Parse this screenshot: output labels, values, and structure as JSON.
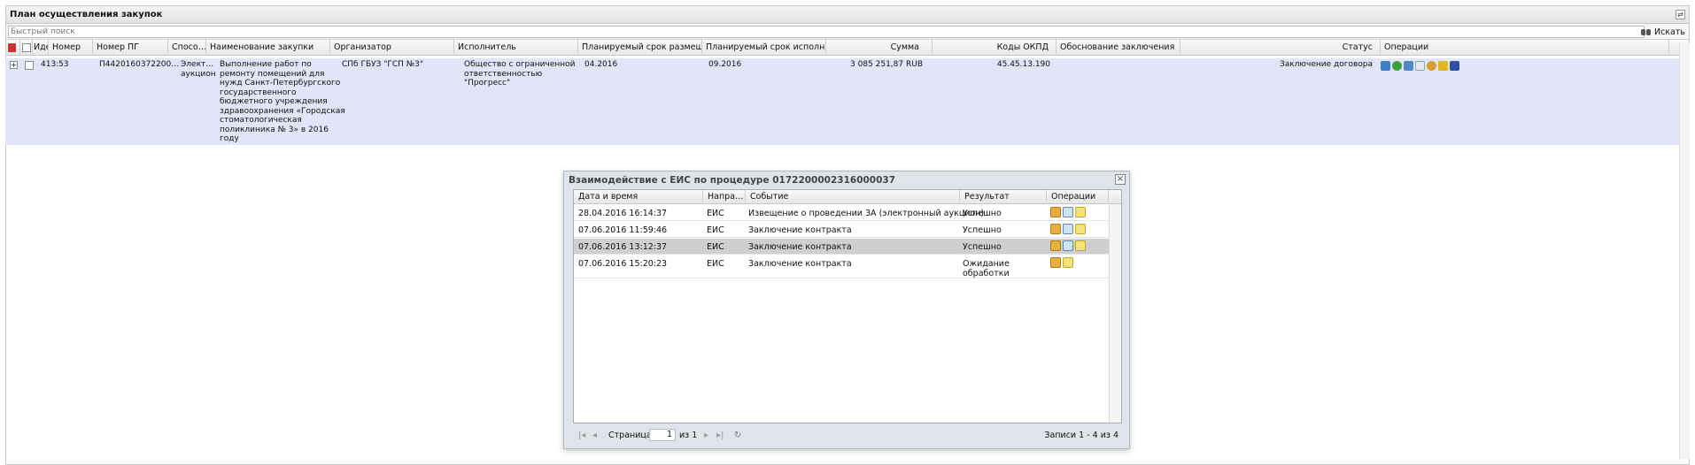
{
  "panel": {
    "title": "План осуществления закупок"
  },
  "search": {
    "placeholder": "Быстрый поиск",
    "button_label": "Искать"
  },
  "grid": {
    "columns": {
      "id": "Иде",
      "number": "Номер",
      "pg_number": "Номер ПГ",
      "method": "Спосо…",
      "name": "Наименование закупки",
      "organizer": "Организатор",
      "executor": "Исполнитель",
      "plan_post": "Планируемый срок размещ…",
      "plan_exec": "Планируемый срок исполн…",
      "sum": "Сумма",
      "okpd": "Коды ОКПД",
      "justification": "Обоснование заключения",
      "status": "Статус",
      "operations": "Операции"
    },
    "row": {
      "id": "413:",
      "number": "53",
      "pg_number": "П4420160372200…",
      "method": "Элект…\nаукцион",
      "name": "Выполнение работ по\nремонту помещений для\nнужд Санкт-Петербургского\nгосударственного\nбюджетного учреждения\nздравоохранения «Городская\nстоматологическая\nполиклиника № 3» в 2016\nгоду",
      "organizer": "СПб ГБУЗ \"ГСП №3\"",
      "executor": "Общество с ограниченной\nответственностью\n\"Прогресс\"",
      "plan_post": "04.2016",
      "plan_exec": "09.2016",
      "sum": "3 085 251,87 RUB",
      "okpd": "45.45.13.190",
      "justification": "",
      "status": "Заключение договора"
    }
  },
  "modal": {
    "title": "Взаимодействие с ЕИС по процедуре 0172200002316000037",
    "columns": {
      "datetime": "Дата и время",
      "direction": "Напра…",
      "event": "Событие",
      "result": "Результат",
      "operations": "Операции"
    },
    "rows": [
      {
        "datetime": "28.04.2016 16:14:37",
        "direction": "ЕИС",
        "event": "Извещение о проведении ЗА (электронный аукцион)",
        "result": "Успешно"
      },
      {
        "datetime": "07.06.2016 11:59:46",
        "direction": "ЕИС",
        "event": "Заключение контракта",
        "result": "Успешно"
      },
      {
        "datetime": "07.06.2016 13:12:37",
        "direction": "ЕИС",
        "event": "Заключение контракта",
        "result": "Успешно"
      },
      {
        "datetime": "07.06.2016 15:20:23",
        "direction": "ЕИС",
        "event": "Заключение контракта",
        "result": "Ожидание\nобработки"
      }
    ],
    "pager": {
      "page_label": "Страница",
      "page_value": "1",
      "of_label": "из 1",
      "records": "Записи 1 - 4 из 4"
    }
  },
  "colors": {
    "selected_row": "#e2e5f8",
    "modal_bg": "#dfe3ea",
    "selected_modal_row": "#cfcfcf"
  }
}
